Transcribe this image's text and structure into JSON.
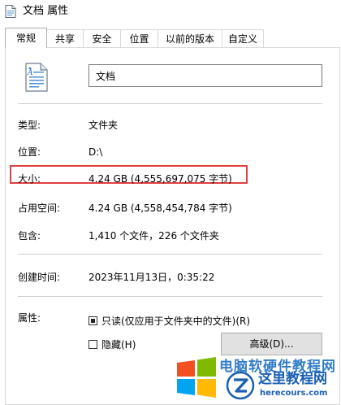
{
  "window": {
    "title": "文档 属性"
  },
  "tabs": [
    {
      "label": "常规",
      "active": true
    },
    {
      "label": "共享",
      "active": false
    },
    {
      "label": "安全",
      "active": false
    },
    {
      "label": "位置",
      "active": false
    },
    {
      "label": "以前的版本",
      "active": false
    },
    {
      "label": "自定义",
      "active": false
    }
  ],
  "general": {
    "folder_name": "文档",
    "type_label": "类型:",
    "type_value": "文件夹",
    "location_label": "位置:",
    "location_value": "D:\\",
    "size_label": "大小:",
    "size_value": "4.24 GB (4,555,697,075 字节)",
    "size_on_disk_label": "占用空间:",
    "size_on_disk_value": "4.24 GB (4,558,454,784 字节)",
    "contains_label": "包含:",
    "contains_value": "1,410 个文件，226 个文件夹",
    "created_label": "创建时间:",
    "created_value": "2023年11月13日，0:35:22",
    "attributes_label": "属性:",
    "readonly_label": "只读(仅应用于文件夹中的文件)(R)",
    "readonly_state": "indeterminate",
    "hidden_label": "隐藏(H)",
    "hidden_state": "unchecked",
    "advanced_button": "高级(D)..."
  },
  "highlight": {
    "color": "#e0403f",
    "target": "size-row"
  },
  "watermark": {
    "ghost_text": "电脑软硬件教程网",
    "cn_text": "这里教程网",
    "en_text": "herecours.com",
    "colors": [
      "#f25022",
      "#7fba00",
      "#00a4ef",
      "#ffb900"
    ]
  },
  "colors": {
    "highlight_border": "#e0403f",
    "button_face": "#e1e1e1",
    "divider": "#cfcfcf",
    "watermark_blue": "#1a5fb4"
  }
}
